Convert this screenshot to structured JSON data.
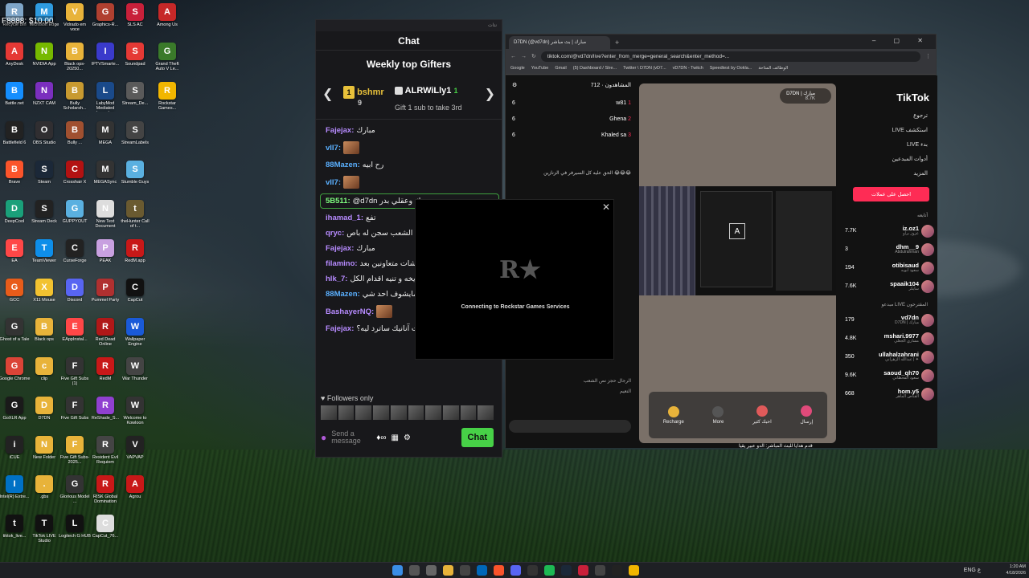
{
  "overlay": {
    "fps": "F8888: $10.00"
  },
  "desktop_icons": [
    {
      "label": "Recycle Bin",
      "color": "#7fa6c8"
    },
    {
      "label": "Microsoft Edge",
      "color": "#2e9be0"
    },
    {
      "label": "Vidrado em voce",
      "color": "#e8b33a"
    },
    {
      "label": "Graphics-R...",
      "color": "#b04030"
    },
    {
      "label": "SLS AC",
      "color": "#c8203a"
    },
    {
      "label": "Among Us",
      "color": "#c62828"
    },
    {
      "label": "AnyDesk",
      "color": "#e53935"
    },
    {
      "label": "NVIDIA App",
      "color": "#76b900"
    },
    {
      "label": "Black ops-20250...",
      "color": "#e8b33a"
    },
    {
      "label": "IPTVSmarte...",
      "color": "#3a3acb"
    },
    {
      "label": "Soundpad",
      "color": "#e53935"
    },
    {
      "label": "Grand Theft Auto V Le...",
      "color": "#3a7a2a"
    },
    {
      "label": "Battle.net",
      "color": "#148eff"
    },
    {
      "label": "NZXT CAM",
      "color": "#7b2fbe"
    },
    {
      "label": "Bully Scholarsh...",
      "color": "#c89a30"
    },
    {
      "label": "LabyMod Mediated Launcher",
      "color": "#1a4a8a"
    },
    {
      "label": "Stream_De...",
      "color": "#5a5a5a"
    },
    {
      "label": "Rockstar Games...",
      "color": "#f2b600"
    },
    {
      "label": "Battlefield 6",
      "color": "#222"
    },
    {
      "label": "OBS Studio",
      "color": "#302e31"
    },
    {
      "label": "Bully ...",
      "color": "#a05030"
    },
    {
      "label": "MEGA",
      "color": "#333"
    },
    {
      "label": "StreamLabels",
      "color": "#444"
    },
    {
      "label": "Brave",
      "color": "#fb542b"
    },
    {
      "label": "Steam",
      "color": "#1b2838"
    },
    {
      "label": "Crosshair X",
      "color": "#b31212"
    },
    {
      "label": "MEGASync",
      "color": "#333"
    },
    {
      "label": "Stumble Guys",
      "color": "#5ab0e0"
    },
    {
      "label": "DeepCool",
      "color": "#1aa07a"
    },
    {
      "label": "Stream Deck",
      "color": "#222"
    },
    {
      "label": "GUPPYOUT",
      "color": "#5ab0e0"
    },
    {
      "label": "New Text Document",
      "color": "#ddd"
    },
    {
      "label": "theHunter Call of t...",
      "color": "#6a5a30"
    },
    {
      "label": "EA",
      "color": "#ff4747"
    },
    {
      "label": "TeamViewer",
      "color": "#0e8ee9"
    },
    {
      "label": "CurseForge",
      "color": "#222"
    },
    {
      "label": "PEAK",
      "color": "#c8a0e0"
    },
    {
      "label": "RedM.app",
      "color": "#c81818"
    },
    {
      "label": "GCC",
      "color": "#e85c1a"
    },
    {
      "label": "X11 Mouse",
      "color": "#f2c230"
    },
    {
      "label": "Discord",
      "color": "#5865f2"
    },
    {
      "label": "Pummel Party",
      "color": "#b03030"
    },
    {
      "label": "CapCut",
      "color": "#111"
    },
    {
      "label": "Ghost of a Tale",
      "color": "#333"
    },
    {
      "label": "Black ops",
      "color": "#e8b33a"
    },
    {
      "label": "EAppInstal...",
      "color": "#ff4747"
    },
    {
      "label": "Red Dead Online",
      "color": "#b01818"
    },
    {
      "label": "Wallpaper Engine",
      "color": "#1a5ad8"
    },
    {
      "label": "Google Chrome",
      "color": "#db4437"
    },
    {
      "label": "clip",
      "color": "#e8b33a"
    },
    {
      "label": "Five Gift Subs (1)",
      "color": "#333"
    },
    {
      "label": "RedM",
      "color": "#c81818"
    },
    {
      "label": "War Thunder",
      "color": "#444"
    },
    {
      "label": "GoXLR App",
      "color": "#1a1a1a"
    },
    {
      "label": "D7DN",
      "color": "#e8b33a"
    },
    {
      "label": "Five Gift Subs",
      "color": "#333"
    },
    {
      "label": "ReShade_S...",
      "color": "#9040d0"
    },
    {
      "label": "Welcome to Kowloon",
      "color": "#333"
    },
    {
      "label": "iCUE",
      "color": "#222"
    },
    {
      "label": "New Folder",
      "color": "#e8b33a"
    },
    {
      "label": "Five Gift Subs-2025...",
      "color": "#e8b33a"
    },
    {
      "label": "Resident Evil Requiem",
      "color": "#444"
    },
    {
      "label": "VAPVAP",
      "color": "#222"
    },
    {
      "label": "Intel(R) Extre...",
      "color": "#0071c5"
    },
    {
      "label": ".gbs",
      "color": "#e8b33a"
    },
    {
      "label": "Glorious Model ...",
      "color": "#333"
    },
    {
      "label": "RISK Global Domination",
      "color": "#c81818"
    },
    {
      "label": "Agrou",
      "color": "#c81818"
    },
    {
      "label": "tiktok_live...",
      "color": "#111"
    },
    {
      "label": "TikTok LIVE Studio",
      "color": "#111"
    },
    {
      "label": "Logitech G HUB",
      "color": "#111"
    },
    {
      "label": "CapCut_76...",
      "color": "#ddd"
    }
  ],
  "twitch": {
    "topbar": "نتات",
    "title": "Chat",
    "gifters_title": "Weekly top Gifters",
    "gifter1": {
      "name": "bshmr",
      "count": "9",
      "rank": "1"
    },
    "gifter2": {
      "name": "ALRWiLly1",
      "count": "1"
    },
    "gift_hint": "Gift 1 sub to take 3rd",
    "messages": [
      {
        "user": "Fajejax:",
        "text": "مبارك",
        "color": "#b78bff"
      },
      {
        "user": "vII7:",
        "text": "",
        "color": "#5ab0ff",
        "emote": true
      },
      {
        "user": "88Mazen:",
        "text": "رح ابيه",
        "color": "#5ab0ff"
      },
      {
        "user": "vII7:",
        "text": "",
        "color": "#5ab0ff",
        "emote": true
      },
      {
        "user": "5B511:",
        "text": "@d7dn يحترك وعقلي بدر",
        "color": "#7fff7f",
        "highlight": true
      },
      {
        "user": "ihamad_1:",
        "text": "تفع",
        "color": "#b78bff"
      },
      {
        "user": "qryc:",
        "text": "عبدالله بوز سجن الشعب سجن له باص",
        "color": "#b78bff"
      },
      {
        "user": "Fajejax:",
        "text": "مبارك",
        "color": "#b78bff"
      },
      {
        "user": "filamino:",
        "text": "التميمي مع بعض صدامات وهوشات متعاونين بعد",
        "color": "#b78bff"
      },
      {
        "user": "hlk_7:",
        "text": "ويخه و تنيه اقدام الكل",
        "color": "#b78bff"
      },
      {
        "user": "88Mazen:",
        "text": "جزك مايشوف احد شي",
        "color": "#5ab0ff"
      },
      {
        "user": "BashayerNQ:",
        "text": "",
        "color": "#b78bff",
        "emote": true
      },
      {
        "user": "Fajejax:",
        "text": "ت آنانيك ساترد ليه؟",
        "color": "#b78bff"
      }
    ],
    "followers_only": "Followers only",
    "input_placeholder": "Send a message",
    "chat_button": "Chat"
  },
  "rockstar": {
    "status": "Connecting to Rockstar Games Services",
    "logo": "R★"
  },
  "browser": {
    "tab_title": "D7DN (@vd7dn) مبارك | بث مباشر",
    "url": "tiktok.com/@vd7dn/live?enter_from_merge=general_search&enter_method=...",
    "bookmarks": [
      "Google",
      "YouTube",
      "Gmail",
      "(5) Dashboard / Stre...",
      "Twitter \\ D7DN (vD7...",
      "vD7DN - Twitch",
      "Speedtest by Ookla...",
      "الوظائف المتاحة"
    ],
    "viewers_header": "المشاهدون · 712",
    "viewers": [
      {
        "name": "w81",
        "rank": "1",
        "count": "6"
      },
      {
        "name": "Ghena",
        "rank": "2",
        "count": "6"
      },
      {
        "name": "Khaled sa",
        "rank": "3",
        "count": "6"
      }
    ],
    "live_comment": "الحق عليه كل السيرفر في الزنازين 😂😂😂",
    "comment2": "الرجال حجز نص الشعب",
    "comment3": "النعيم",
    "host": {
      "name": "D7DN | مبارك",
      "likes": "8.7K"
    },
    "gifts": [
      {
        "label": "Recharge"
      },
      {
        "label": "More"
      },
      {
        "label": "احبك كثير"
      },
      {
        "label": "إرسال"
      }
    ],
    "bottom_banner": "قدم هدايا للبث المباشر: الدو عبير يقيا",
    "sidebar": {
      "logo": "TikTok",
      "nav": [
        "ترجوع",
        "LIVE استكشف",
        "LIVE بدء",
        "أدوات المبدعين",
        "المزيد"
      ],
      "get_coins": "احصل على عملات",
      "following_header": "أتابعه",
      "following": [
        {
          "name": "iz.oz1",
          "sub": "عزوز براو",
          "count": "7.7K"
        },
        {
          "name": "dhm__9",
          "sub": "Abdulrahman",
          "count": "3"
        },
        {
          "name": "otibisaud",
          "sub": "سعود ابوبه",
          "count": "194"
        },
        {
          "name": "spaaik104",
          "sub": "سايكر",
          "count": "7.6K"
        }
      ],
      "suggested_header": "مبدعو LIVE المقترحون",
      "suggested": [
        {
          "name": "vd7dn",
          "sub": "D7DN | مبارك",
          "count": "179"
        },
        {
          "name": "mshari.9977",
          "sub": "مشاري الجعلي",
          "count": "4.8K"
        },
        {
          "name": "ullahalzahrani",
          "sub": "عبدالله الزهراني | ✦",
          "count": "350"
        },
        {
          "name": "saoud_qh70",
          "sub": "سعود القحطاني",
          "count": "9.6K"
        },
        {
          "name": "hom.y5",
          "sub": "القناص الماهر",
          "count": "668"
        }
      ]
    }
  },
  "taskbar": {
    "time": "1:20 AM",
    "date": "4/18/2026",
    "lang": "ENG",
    "lang2": "ع"
  }
}
